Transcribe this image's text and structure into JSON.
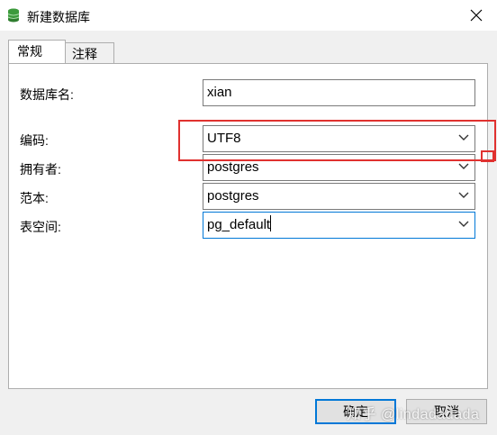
{
  "window": {
    "title": "新建数据库"
  },
  "tabs": [
    {
      "label": "常规",
      "active": true
    },
    {
      "label": "注释",
      "active": false
    }
  ],
  "form": {
    "db_name": {
      "label": "数据库名:",
      "value": "xian"
    },
    "encoding": {
      "label": "编码:",
      "value": "UTF8"
    },
    "owner": {
      "label": "拥有者:",
      "value": "postgres"
    },
    "template": {
      "label": "范本:",
      "value": "postgres"
    },
    "tablespace": {
      "label": "表空间:",
      "value": "pg_default"
    }
  },
  "buttons": {
    "ok": "确定",
    "cancel": "取消"
  },
  "watermark": "知乎 @lindadadada",
  "colors": {
    "highlight": "#e0312f",
    "focus": "#0078d7",
    "icon": "#3c9a3c"
  }
}
